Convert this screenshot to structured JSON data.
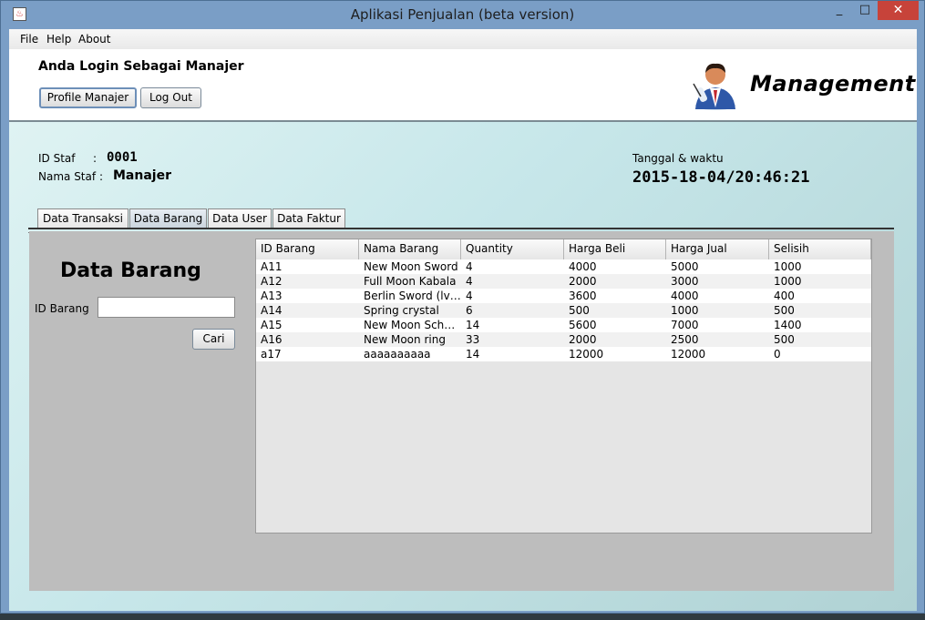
{
  "window": {
    "title": "Aplikasi Penjualan (beta version)",
    "minimize": "_",
    "maximize": "□",
    "close": "✕"
  },
  "menu": [
    "File",
    "Help",
    "About"
  ],
  "header": {
    "login_text": "Anda Login Sebagai Manajer",
    "profile_button": "Profile Manajer",
    "logout_button": "Log Out",
    "role_title": "Management",
    "role_icon": "manager-avatar-icon"
  },
  "staff": {
    "id_label": "ID Staf",
    "id_sep": ":",
    "id_value": "0001",
    "name_label": "Nama Staf",
    "name_sep": ":",
    "name_value": "Manajer"
  },
  "datetime": {
    "label": "Tanggal & waktu",
    "value": "2015-18-04/20:46:21"
  },
  "tabs": [
    "Data Transaksi",
    "Data Barang",
    "Data User",
    "Data Faktur"
  ],
  "active_tab": "Data Barang",
  "panel": {
    "title": "Data Barang",
    "search_label": "ID Barang",
    "search_value": "",
    "search_button": "Cari"
  },
  "table": {
    "columns": [
      "ID Barang",
      "Nama Barang",
      "Quantity",
      "Harga Beli",
      "Harga Jual",
      "Selisih"
    ],
    "rows": [
      [
        "A11",
        "New Moon Sword",
        "4",
        "4000",
        "5000",
        "1000"
      ],
      [
        "A12",
        "Full Moon Kabala",
        "4",
        "2000",
        "3000",
        "1000"
      ],
      [
        "A13",
        "Berlin Sword (lvl ...",
        "4",
        "3600",
        "4000",
        "400"
      ],
      [
        "A14",
        "Spring crystal",
        "6",
        "500",
        "1000",
        "500"
      ],
      [
        "A15",
        "New Moon Schm...",
        "14",
        "5600",
        "7000",
        "1400"
      ],
      [
        "A16",
        "New Moon ring",
        "33",
        "2000",
        "2500",
        "500"
      ],
      [
        "a17",
        "aaaaaaaaaa",
        "14",
        "12000",
        "12000",
        "0"
      ]
    ]
  },
  "colors": {
    "titlebar": "#7a9ec6",
    "close_button": "#c7433a",
    "panel": "#bdbdbd",
    "content_bg": "#c7e7ea"
  }
}
